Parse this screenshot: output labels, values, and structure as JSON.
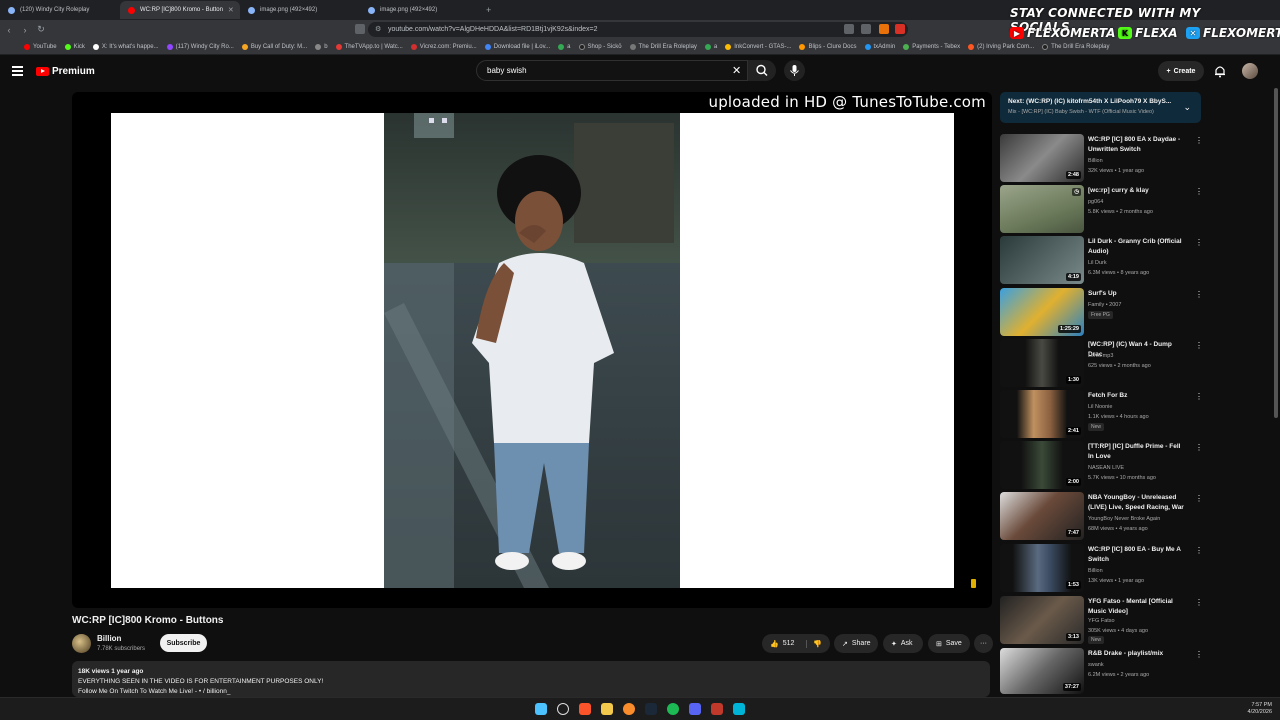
{
  "browser": {
    "tabs": [
      {
        "label": "(120) Windy City Roleplay",
        "active": false
      },
      {
        "label": "WC:RP [IC]800 Kromo - Button",
        "active": true
      },
      {
        "label": "image.png (492×492)",
        "active": false
      },
      {
        "label": "image.png (492×492)",
        "active": false
      }
    ],
    "url": "youtube.com/watch?v=AlgDHeHDDA&list=RD1Btj1vjK92s&index=2",
    "bookmarks": [
      "YouTube",
      "Kick",
      "X: It's what's happe...",
      "(117) Windy City Ro...",
      "Buy Call of Duty: M...",
      "b",
      "TheTVApp.to | Watc...",
      "Vicrez.com: Premiu...",
      "Download file | iLov...",
      "a",
      "Shop - Sickō",
      "The Drill Era Roleplay",
      "a",
      "InkConvert - GTAS-...",
      "Blips - Clure Docs",
      "txAdmin",
      "Payments - Tebex",
      "(2) Irving Park Com...",
      "The Drill Era Roleplay"
    ]
  },
  "socials": {
    "title": "STAY CONNECTED WITH MY SOCIALS",
    "youtube": "FLEXOMERTA",
    "kick": "FLEXA",
    "x": "FLEXOMERTA"
  },
  "header": {
    "logo": "Premium",
    "search_query": "baby swish",
    "create_label": "Create"
  },
  "player": {
    "watermark": "uploaded in HD @ TunesToTube.com"
  },
  "video": {
    "title": "WC:RP [IC]800 Kromo - Buttons",
    "channel": "Billion",
    "subscribers": "7.78K subscribers",
    "subscribe_label": "Subscribe",
    "likes": "512",
    "share_label": "Share",
    "ask_label": "Ask",
    "save_label": "Save",
    "views_date": "18K views  1 year ago",
    "desc_line1": "EVERYTHING SEEN IN THE VIDEO IS FOR ENTERTAINMENT PURPOSES ONLY!",
    "desc_line2": "Follow Me On Twitch To Watch Me Live! - • / billionn_"
  },
  "upnext": {
    "title": "Next: (WC:RP) (IC) kitofrm54th X LilPooh79 X BbyS...",
    "subtitle": "Mix - [WC:RP] (IC) Baby Swish - WTF (Official Music Video)"
  },
  "recommendations": [
    {
      "title": "WC:RP [IC] 800 EA x Daydae - Unwritten Switch",
      "channel": "Billion",
      "meta": "32K views • 1 year ago",
      "duration": "2:48",
      "badge": ""
    },
    {
      "title": "[wc:rp] curry & klay",
      "channel": "pg064",
      "meta": "5.8K views • 2 months ago",
      "duration": "",
      "badge": ""
    },
    {
      "title": "Lil Durk - Granny Crib (Official Audio)",
      "channel": "Lil Durk",
      "meta": "6.3M views • 8 years ago",
      "duration": "4:19",
      "badge": ""
    },
    {
      "title": "Surf's Up",
      "channel": "Family • 2007",
      "meta": "",
      "duration": "1:25:29",
      "badge": "Free  PG"
    },
    {
      "title": "[WC:RP] (IC) Wan 4 - Dump Drac",
      "channel": "Lenci.mp3",
      "meta": "625 views • 2 months ago",
      "duration": "1:30",
      "badge": ""
    },
    {
      "title": "Fetch For Bz",
      "channel": "Lil Noonie",
      "meta": "1.1K views • 4 hours ago",
      "duration": "2:41",
      "badge": "New"
    },
    {
      "title": "[TT:RP] [IC] Duffle Prime - Fell In Love",
      "channel": "NASEAN LIVE",
      "meta": "5.7K views • 10 months ago",
      "duration": "2:00",
      "badge": ""
    },
    {
      "title": "NBA YoungBoy - Unreleased (LIVE) Live, Speed Racing, War",
      "channel": "YoungBoy Never Broke Again",
      "meta": "68M views • 4 years ago",
      "duration": "7:47",
      "badge": ""
    },
    {
      "title": "WC:RP [IC] 800 EA - Buy Me A Switch",
      "channel": "Billion",
      "meta": "13K views • 1 year ago",
      "duration": "1:53",
      "badge": ""
    },
    {
      "title": "YFG Fatso - Mental [Official Music Video]",
      "channel": "YFG Fatso",
      "meta": "305K views • 4 days ago",
      "duration": "3:13",
      "badge": "New"
    },
    {
      "title": "R&B Drake - playlist/mix",
      "channel": "swank",
      "meta": "6.2M views • 2 years ago",
      "duration": "37:27",
      "badge": ""
    }
  ],
  "taskbar": {
    "time": "7:57 PM",
    "date": "4/20/2026"
  }
}
